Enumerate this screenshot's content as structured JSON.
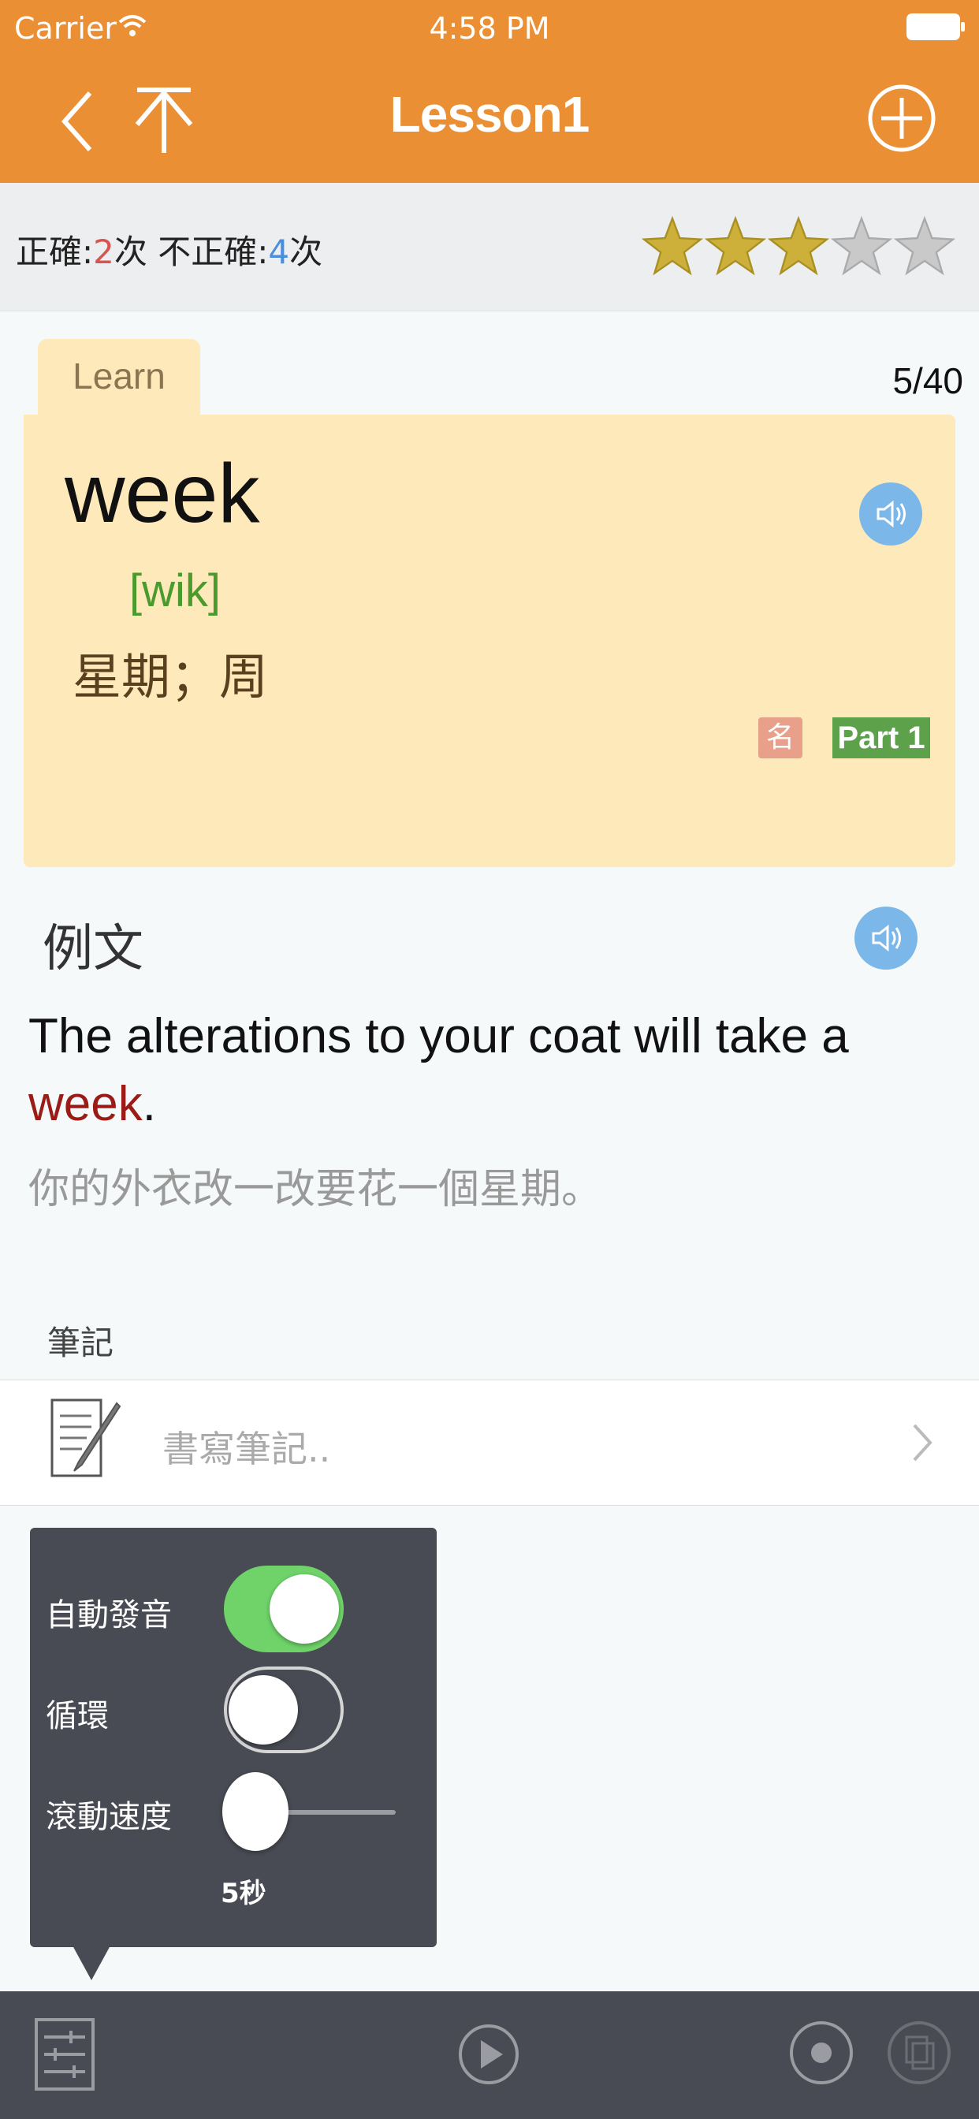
{
  "status": {
    "carrier": "Carrier",
    "time": "4:58 PM"
  },
  "nav": {
    "title": "Lesson1",
    "back_icon": "chevron-left-icon",
    "top_icon": "jump-to-top-icon",
    "add_icon": "add-circle-icon"
  },
  "stats": {
    "correct_label": "正確:",
    "correct_count": "2",
    "times1": "次",
    "incorrect_label": "不正確:",
    "incorrect_count": "4",
    "times2": "次",
    "rating": 3,
    "rating_max": 5
  },
  "card": {
    "tab": "Learn",
    "progress": "5/40",
    "word": "week",
    "phonetic": "[wik]",
    "meaning": "星期；周",
    "pos": "名",
    "part": "Part 1"
  },
  "example": {
    "heading": "例文",
    "en_before": "The alterations to your coat will take a ",
    "en_highlight": "week",
    "en_after": ".",
    "zh": "你的外衣改一改要花一個星期。"
  },
  "notes": {
    "heading": "筆記",
    "placeholder": "書寫筆記.."
  },
  "popover": {
    "auto_pronounce": "自動發音",
    "auto_pronounce_on": true,
    "loop": "循環",
    "loop_on": false,
    "scroll_speed": "滾動速度",
    "scroll_value": "5秒",
    "scroll_level": 0
  },
  "colors": {
    "brand": "#ea8f33",
    "toggle_on": "#6fd36a",
    "card_bg": "#fde9b9"
  }
}
